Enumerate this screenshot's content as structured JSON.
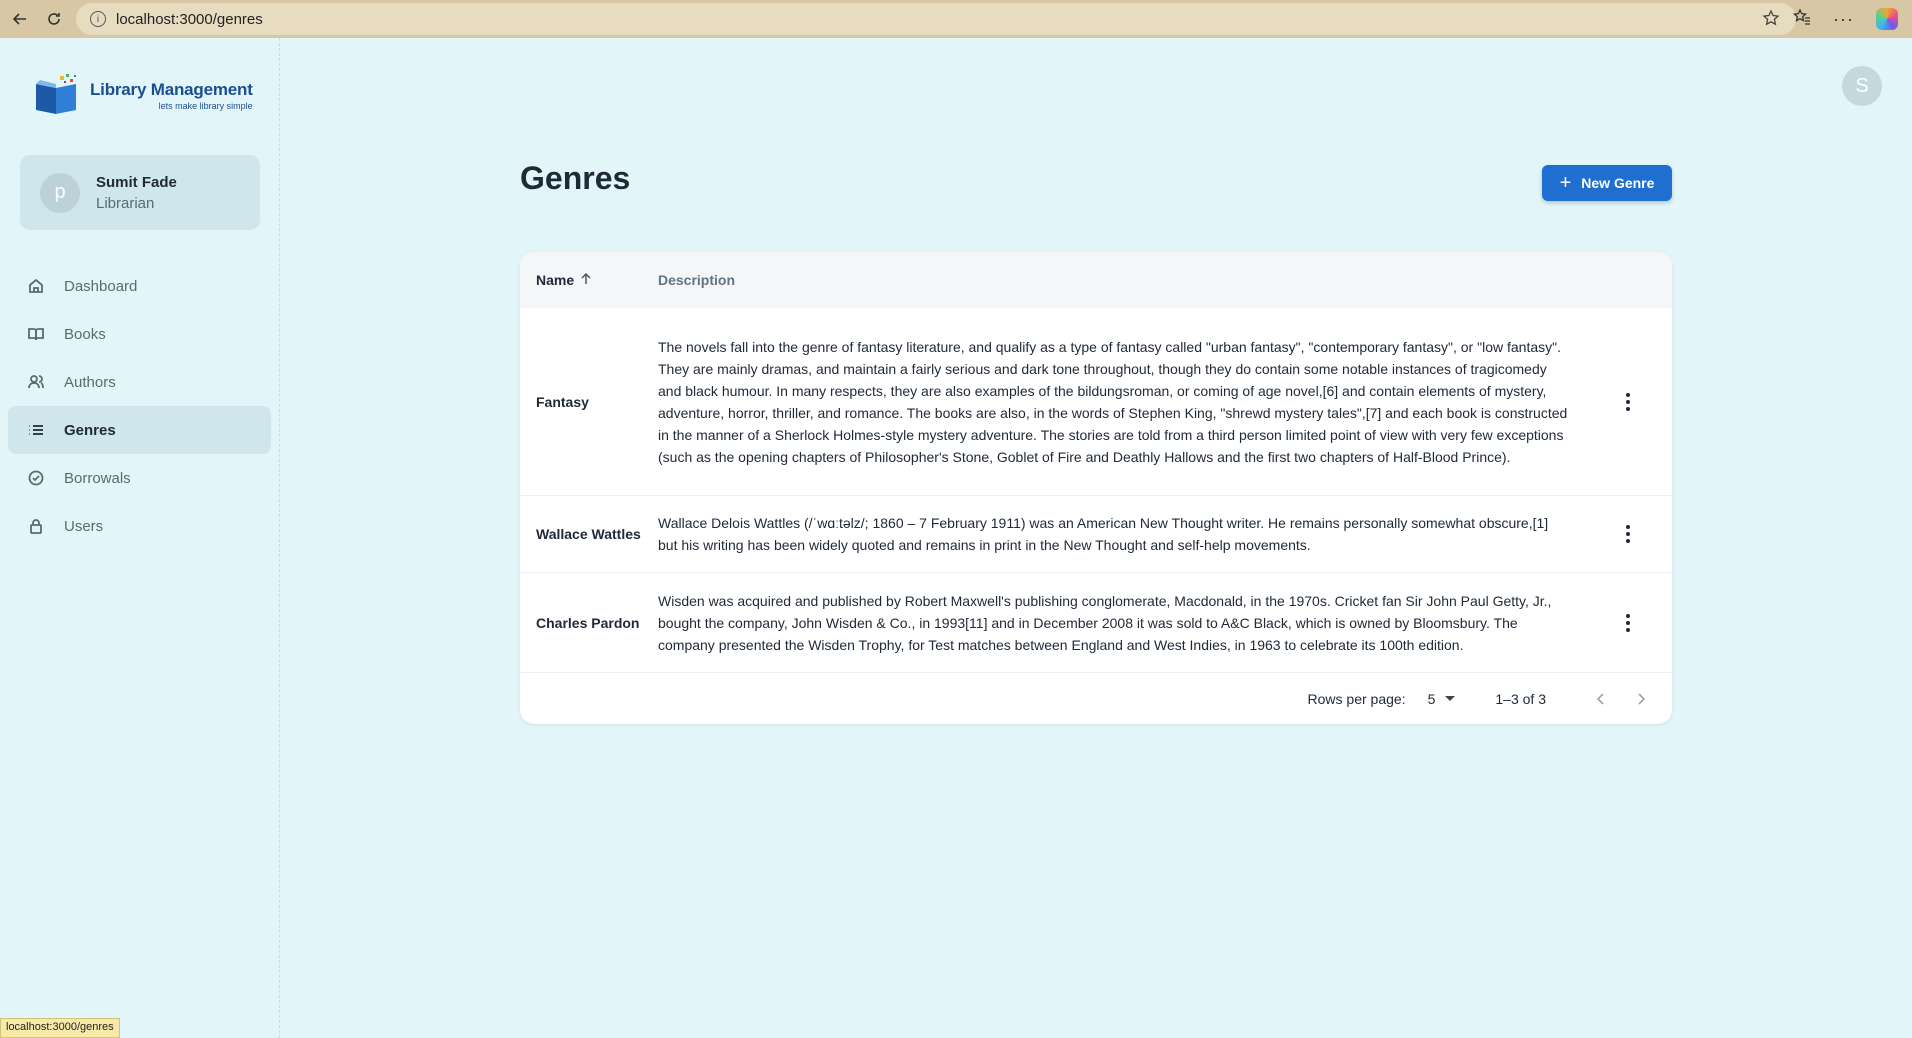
{
  "browser": {
    "url": "localhost:3000/genres",
    "status_url": "localhost:3000/genres"
  },
  "logo": {
    "title": "Library Management",
    "subtitle": "lets make library simple"
  },
  "user": {
    "avatar_letter": "p",
    "name": "Sumit Fade",
    "role": "Librarian"
  },
  "top_avatar_letter": "S",
  "sidebar": {
    "items": [
      {
        "label": "Dashboard",
        "icon": "home-icon"
      },
      {
        "label": "Books",
        "icon": "book-icon"
      },
      {
        "label": "Authors",
        "icon": "users-icon"
      },
      {
        "label": "Genres",
        "icon": "list-icon",
        "active": true
      },
      {
        "label": "Borrowals",
        "icon": "check-circle-icon"
      },
      {
        "label": "Users",
        "icon": "lock-icon"
      }
    ]
  },
  "page": {
    "title": "Genres",
    "new_button": "New Genre"
  },
  "table": {
    "columns": [
      "Name",
      "Description"
    ],
    "rows": [
      {
        "name": "Fantasy",
        "description": "The novels fall into the genre of fantasy literature, and qualify as a type of fantasy called \"urban fantasy\", \"contemporary fantasy\", or \"low fantasy\". They are mainly dramas, and maintain a fairly serious and dark tone throughout, though they do contain some notable instances of tragicomedy and black humour. In many respects, they are also examples of the bildungsroman, or coming of age novel,[6] and contain elements of mystery, adventure, horror, thriller, and romance. The books are also, in the words of Stephen King, \"shrewd mystery tales\",[7] and each book is constructed in the manner of a Sherlock Holmes-style mystery adventure. The stories are told from a third person limited point of view with very few exceptions (such as the opening chapters of Philosopher's Stone, Goblet of Fire and Deathly Hallows and the first two chapters of Half-Blood Prince)."
      },
      {
        "name": "Wallace Wattles",
        "description": "Wallace Delois Wattles (/ˈwɑːtəlz/; 1860 – 7 February 1911) was an American New Thought writer. He remains personally somewhat obscure,[1] but his writing has been widely quoted and remains in print in the New Thought and self-help movements."
      },
      {
        "name": "Charles Pardon",
        "description": "Wisden was acquired and published by Robert Maxwell's publishing conglomerate, Macdonald, in the 1970s. Cricket fan Sir John Paul Getty, Jr., bought the company, John Wisden & Co., in 1993[11] and in December 2008 it was sold to A&C Black, which is owned by Bloomsbury. The company presented the Wisden Trophy, for Test matches between England and West Indies, in 1963 to celebrate its 100th edition."
      }
    ]
  },
  "pagination": {
    "rows_per_page_label": "Rows per page:",
    "rows_per_page": "5",
    "range": "1–3 of 3"
  }
}
